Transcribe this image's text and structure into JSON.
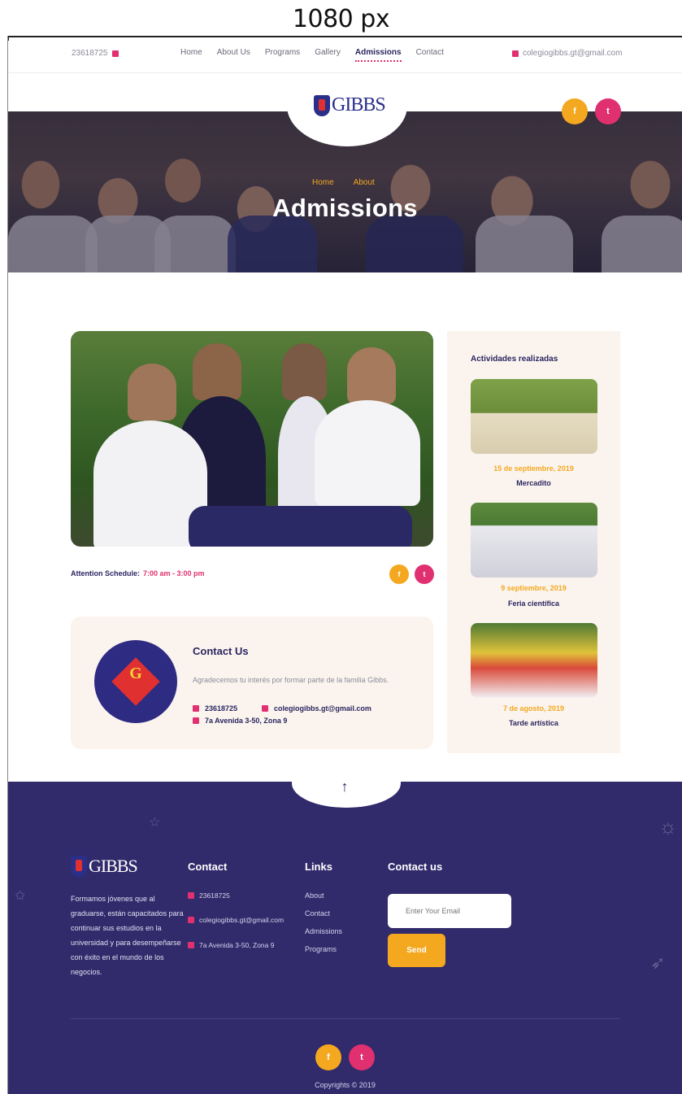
{
  "annotation": {
    "width_label": "1080 px"
  },
  "topbar": {
    "phone": "23618725",
    "email": "colegiogibbs.gt@gmail.com",
    "nav": [
      "Home",
      "About Us",
      "Programs",
      "Gallery",
      "Admissions",
      "Contact"
    ],
    "active_nav": "Admissions"
  },
  "brand": {
    "name": "GIBBS"
  },
  "hero": {
    "breadcrumb": [
      "Home",
      "About"
    ],
    "title": "Admissions"
  },
  "social": {
    "facebook_glyph": "f",
    "twitter_glyph": "t"
  },
  "main": {
    "schedule_label": "Attention Schedule:",
    "schedule_time": "7:00 am - 3:00 pm",
    "contact_card": {
      "title": "Contact Us",
      "text": "Agradecemos tu interés por formar parte de la familia Gibbs.",
      "phone": "23618725",
      "email": "colegiogibbs.gt@gmail.com",
      "address": "7a Avenida 3-50, Zona 9",
      "logo_letters": "G"
    }
  },
  "sidebar": {
    "title": "Actividades realizadas",
    "activities": [
      {
        "date": "15 de septiembre, 2019",
        "name": "Mercadito"
      },
      {
        "date": "9 septiembre, 2019",
        "name": "Feria científica"
      },
      {
        "date": "7 de agosto, 2019",
        "name": "Tarde artística"
      }
    ]
  },
  "footer": {
    "up_arrow": "↑",
    "description": "Formamos jóvenes que al graduarse, están capacitados para continuar sus estudios en la universidad y para desempeñarse con éxito en el mundo de los negocios.",
    "contact_heading": "Contact",
    "phone": "23618725",
    "email": "colegiogibbs.gt@gmail.com",
    "address": "7a Avenida 3-50, Zona 9",
    "links_heading": "Links",
    "links": [
      "About",
      "Contact",
      "Admissions",
      "Programs"
    ],
    "newsletter_heading": "Contact us",
    "email_placeholder": "Enter Your Email",
    "send_label": "Send",
    "copyright": "Copyrights © 2019"
  },
  "colors": {
    "navy": "#2a2560",
    "footer_bg": "#312a6b",
    "accent_orange": "#f3a81f",
    "accent_pink": "#e0306f",
    "card_bg": "#fbf4ee"
  }
}
